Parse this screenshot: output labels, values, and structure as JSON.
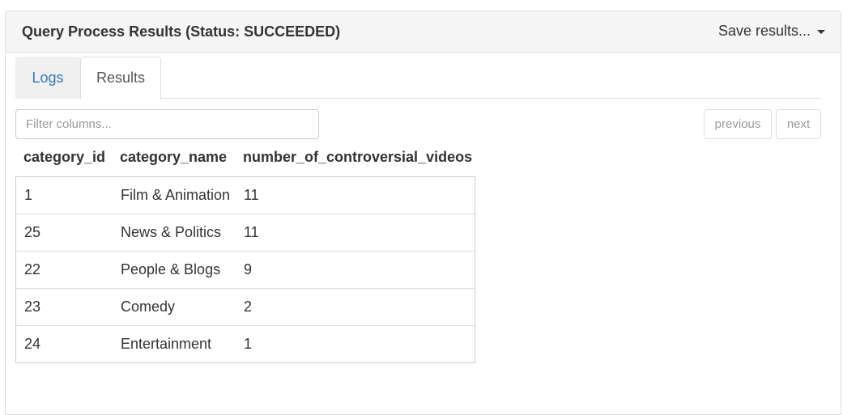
{
  "panel": {
    "title": "Query Process Results (Status: SUCCEEDED)",
    "save_label": "Save results...",
    "save_icon": "caret-down-icon"
  },
  "tabs": [
    {
      "label": "Logs",
      "active": false
    },
    {
      "label": "Results",
      "active": true
    }
  ],
  "filter": {
    "placeholder": "Filter columns...",
    "value": ""
  },
  "pager": {
    "previous_label": "previous",
    "next_label": "next"
  },
  "table": {
    "columns": [
      "category_id",
      "category_name",
      "number_of_controversial_videos"
    ],
    "rows": [
      [
        "1",
        "Film & Animation",
        "11"
      ],
      [
        "25",
        "News & Politics",
        "11"
      ],
      [
        "22",
        "People & Blogs",
        "9"
      ],
      [
        "23",
        "Comedy",
        "2"
      ],
      [
        "24",
        "Entertainment",
        "1"
      ]
    ]
  },
  "colors": {
    "link": "#337ab7",
    "heading_bg": "#f5f5f5",
    "border": "#dddddd"
  }
}
